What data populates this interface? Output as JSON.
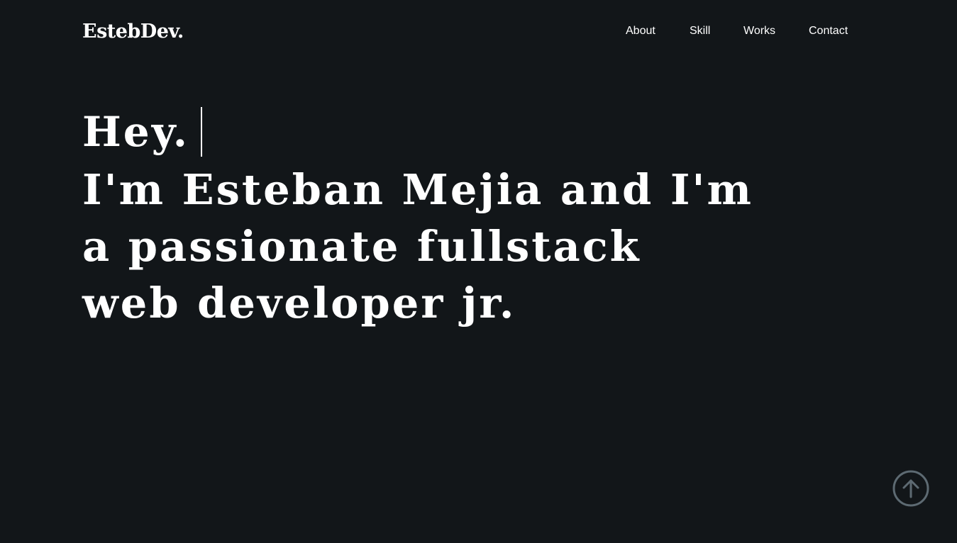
{
  "header": {
    "brand": "EstebDev.",
    "nav": [
      "About",
      "Skill",
      "Works",
      "Contact"
    ]
  },
  "hero": {
    "greeting": "Hey.",
    "headline_lines": [
      "I'm Esteban Mejia and I'm",
      "a passionate fullstack",
      "web developer jr."
    ]
  },
  "scroll_top": {
    "icon": "arrow-up-circle-icon",
    "color": "#5d6a72"
  },
  "colors": {
    "background": "#121619",
    "text": "#ffffff"
  }
}
